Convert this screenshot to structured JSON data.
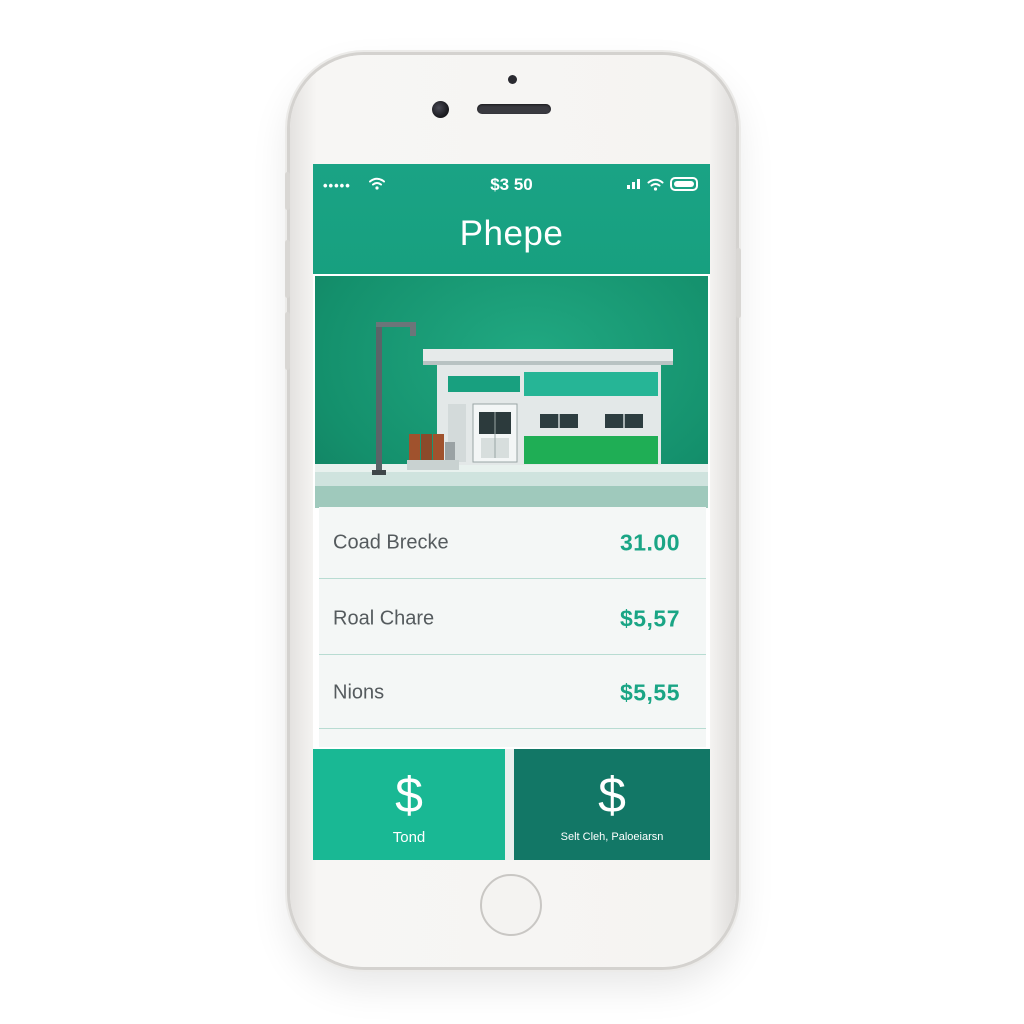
{
  "status_bar": {
    "signal": "•••••",
    "time": "$3 50"
  },
  "header": {
    "title": "Phepe"
  },
  "items": [
    {
      "label": "Coad Brecke",
      "value": "31.00"
    },
    {
      "label": "Roal Chare",
      "value": "$5,57"
    },
    {
      "label": "Nions",
      "value": "$5,55"
    }
  ],
  "actions": [
    {
      "icon": "$",
      "label": "Tond"
    },
    {
      "icon": "$",
      "label": "Selt Cleh, Paloeiarsn"
    }
  ],
  "colors": {
    "accent": "#1aa385",
    "dark_accent": "#127766",
    "button_light": "#19b894"
  }
}
